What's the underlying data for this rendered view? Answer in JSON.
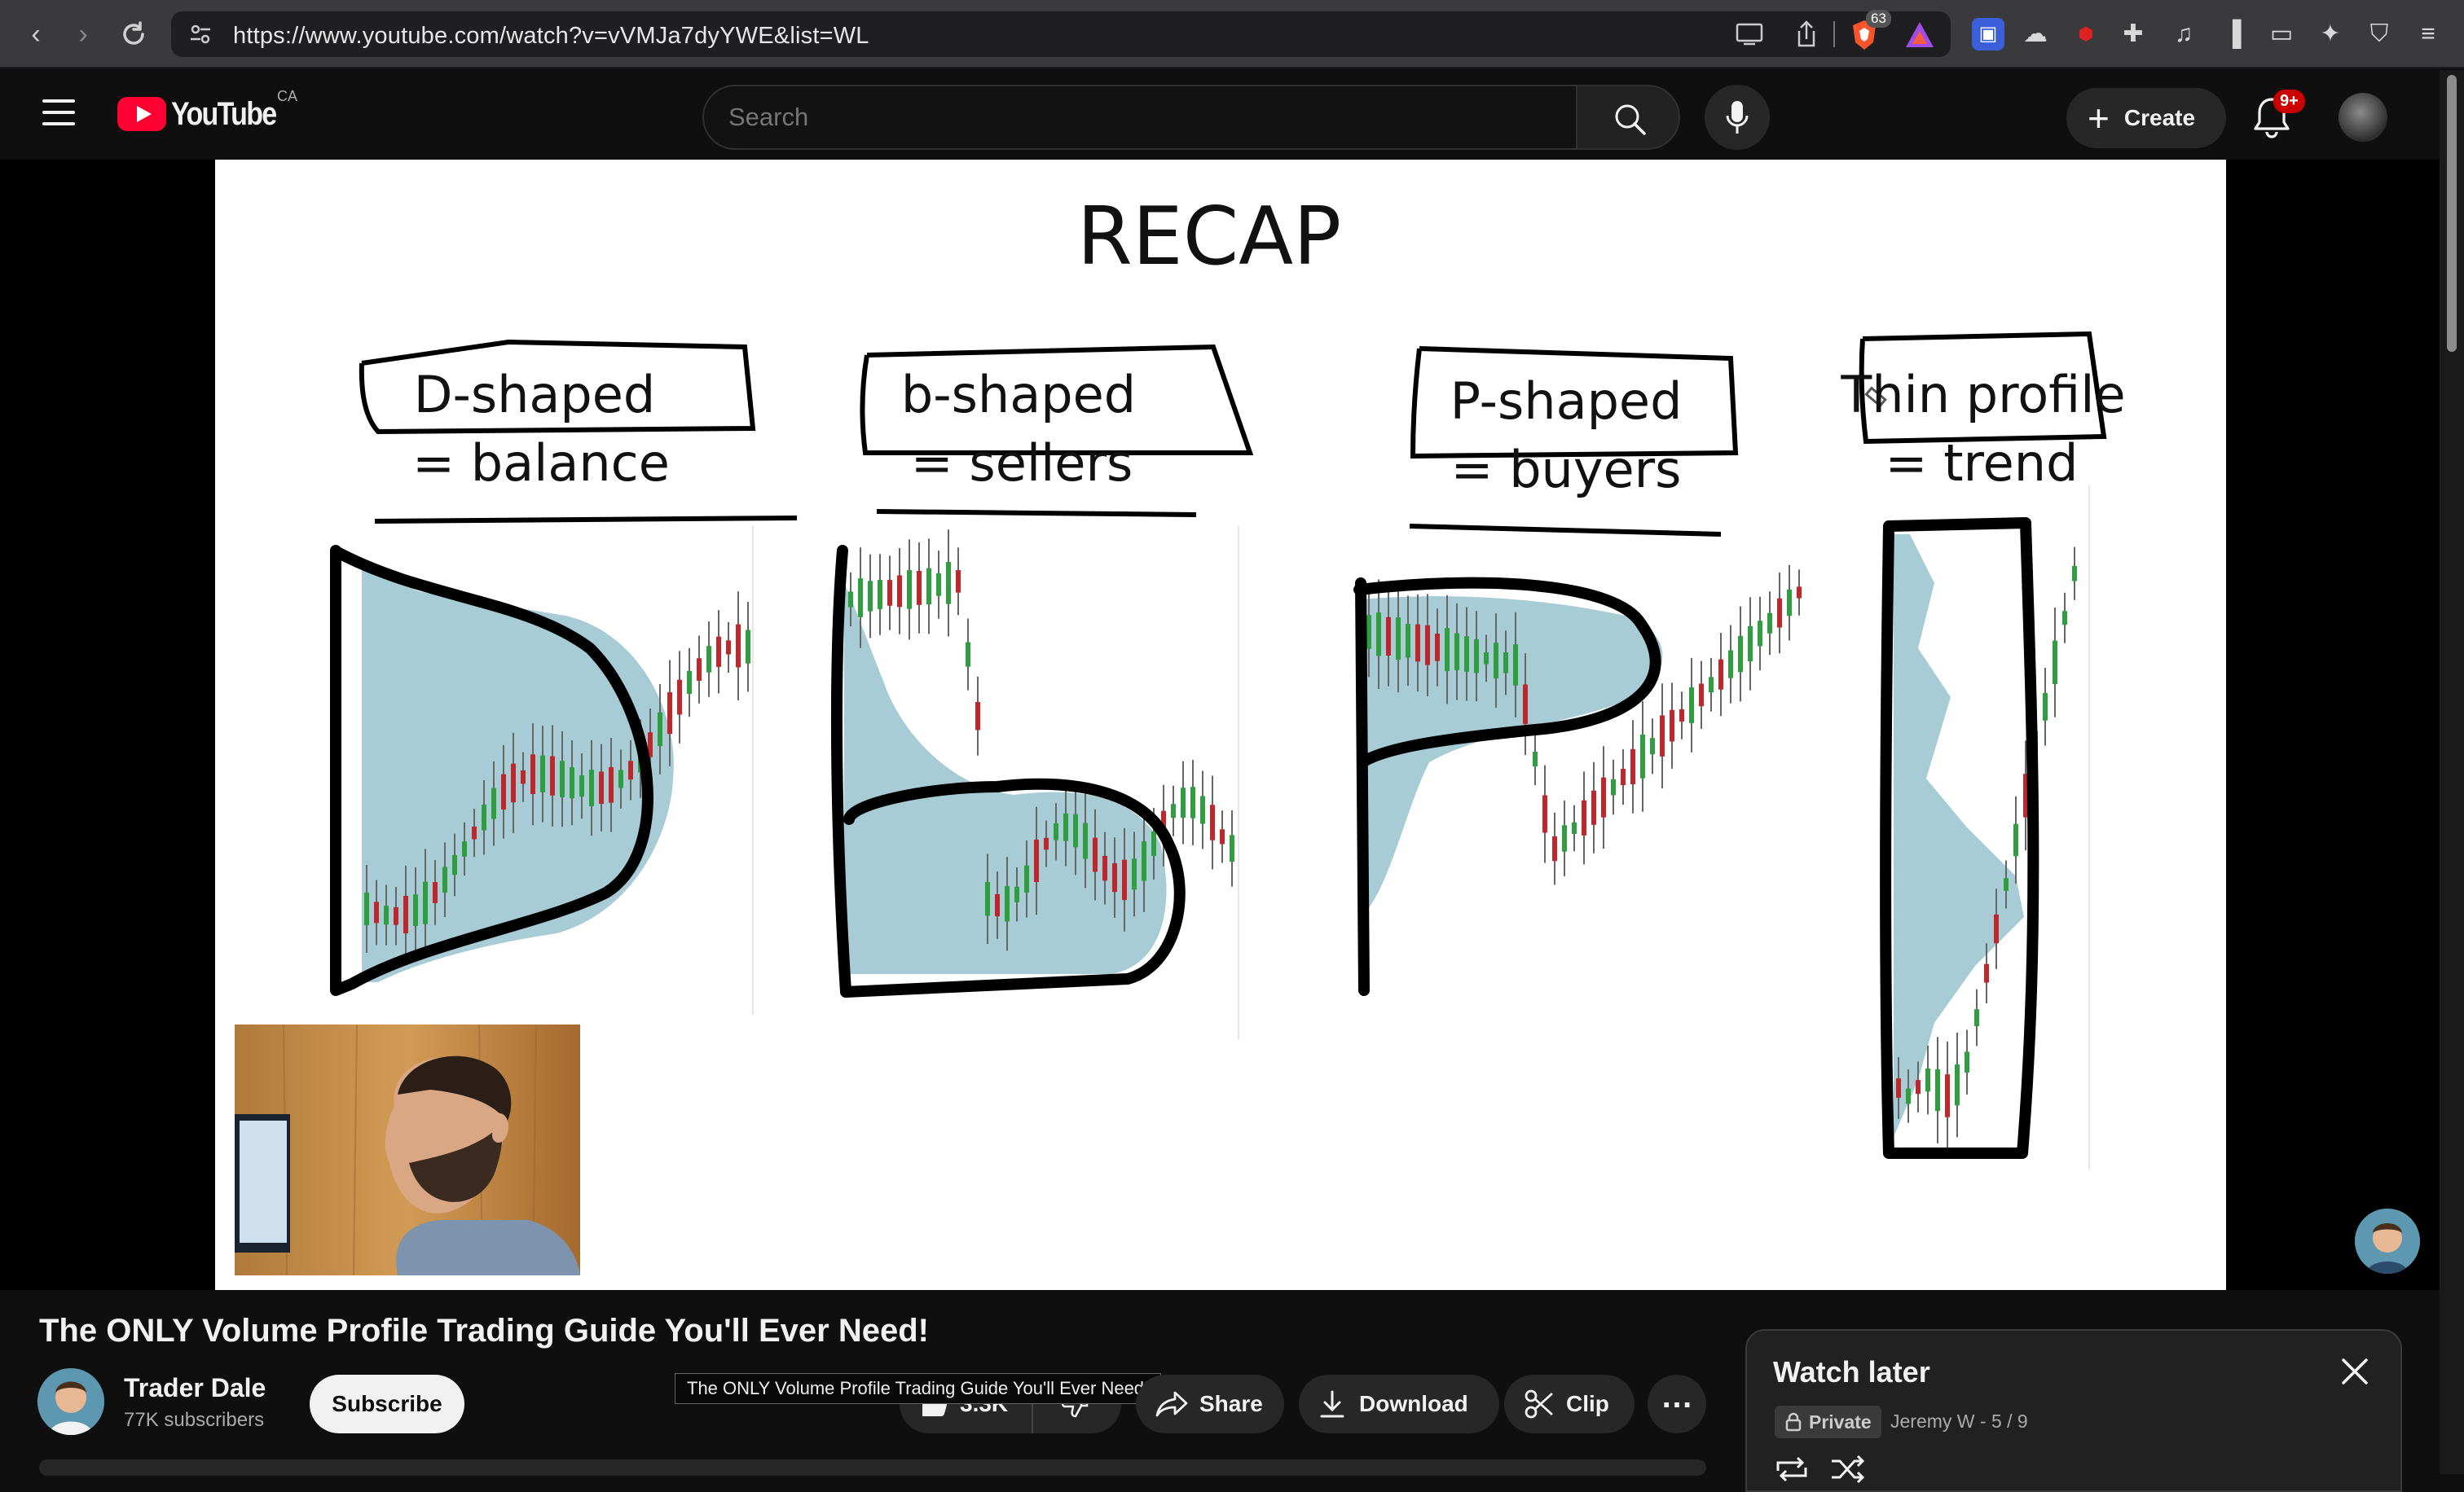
{
  "browser": {
    "url": "https://www.youtube.com/watch?v=vVMJa7dyYWE&list=WL",
    "shield_count": "63"
  },
  "header": {
    "logo_text": "YouTube",
    "region": "CA",
    "search_placeholder": "Search",
    "create_label": "Create",
    "notifications_badge": "9+"
  },
  "slide": {
    "title": "RECAP",
    "panels": [
      {
        "line1": "D-shaped",
        "line2": "= balance"
      },
      {
        "line1": "b-shaped",
        "line2": "= sellers"
      },
      {
        "line1": "P-shaped",
        "line2": "= buyers"
      },
      {
        "line1": "Thin profile",
        "line2": "= trend"
      }
    ]
  },
  "video": {
    "title": "The ONLY Volume Profile Trading Guide You'll Ever Need!",
    "tooltip": "The ONLY Volume Profile Trading Guide You'll Ever Need!",
    "channel_name": "Trader Dale",
    "channel_subs": "77K subscribers",
    "subscribe_label": "Subscribe",
    "like_count": "3.3K",
    "share_label": "Share",
    "download_label": "Download",
    "clip_label": "Clip"
  },
  "watch_later": {
    "title": "Watch later",
    "privacy": "Private",
    "meta": "Jeremy W - 5 / 9"
  },
  "colors": {
    "youtube_red": "#ff0033",
    "profile_fill": "#a8ccd6",
    "candle_up": "#2e9e3e",
    "candle_down": "#c0262a",
    "badge_red": "#cc0000"
  }
}
